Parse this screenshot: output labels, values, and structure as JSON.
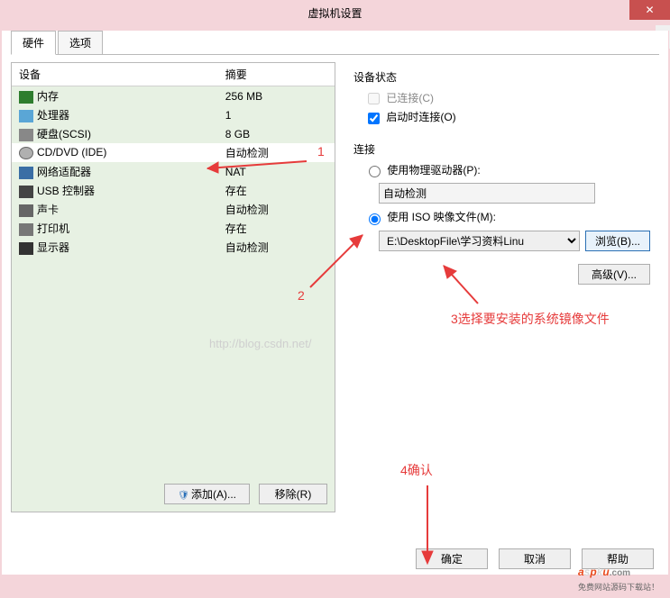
{
  "window": {
    "title": "虚拟机设置",
    "close": "✕"
  },
  "tabs": {
    "hardware": "硬件",
    "options": "选项"
  },
  "list": {
    "col_device": "设备",
    "col_summary": "摘要",
    "rows": [
      {
        "name": "内存",
        "summary": "256 MB",
        "icon": "ic-mem"
      },
      {
        "name": "处理器",
        "summary": "1",
        "icon": "ic-cpu"
      },
      {
        "name": "硬盘(SCSI)",
        "summary": "8 GB",
        "icon": "ic-disk"
      },
      {
        "name": "CD/DVD (IDE)",
        "summary": "自动检测",
        "icon": "ic-cd",
        "selected": true
      },
      {
        "name": "网络适配器",
        "summary": "NAT",
        "icon": "ic-net"
      },
      {
        "name": "USB 控制器",
        "summary": "存在",
        "icon": "ic-usb"
      },
      {
        "name": "声卡",
        "summary": "自动检测",
        "icon": "ic-snd"
      },
      {
        "name": "打印机",
        "summary": "存在",
        "icon": "ic-prn"
      },
      {
        "name": "显示器",
        "summary": "自动检测",
        "icon": "ic-disp"
      }
    ]
  },
  "left_btns": {
    "add": "添加(A)...",
    "remove": "移除(R)"
  },
  "right": {
    "status_title": "设备状态",
    "connected": "已连接(C)",
    "connect_poweron": "启动时连接(O)",
    "conn_title": "连接",
    "use_physical": "使用物理驱动器(P):",
    "physical_value": "自动检测",
    "use_iso": "使用 ISO 映像文件(M):",
    "iso_value": "E:\\DesktopFile\\学习资料Linu",
    "browse": "浏览(B)...",
    "advanced": "高级(V)..."
  },
  "footer": {
    "ok": "确定",
    "cancel": "取消",
    "help": "帮助"
  },
  "annotations": {
    "a1": "1",
    "a2": "2",
    "a3": "3选择要安装的系统镜像文件",
    "a4": "4确认"
  },
  "watermark": "http://blog.csdn.net/",
  "logo": {
    "text": "aspku",
    "tld": ".com",
    "sub": "免费网站源码下载站！"
  }
}
